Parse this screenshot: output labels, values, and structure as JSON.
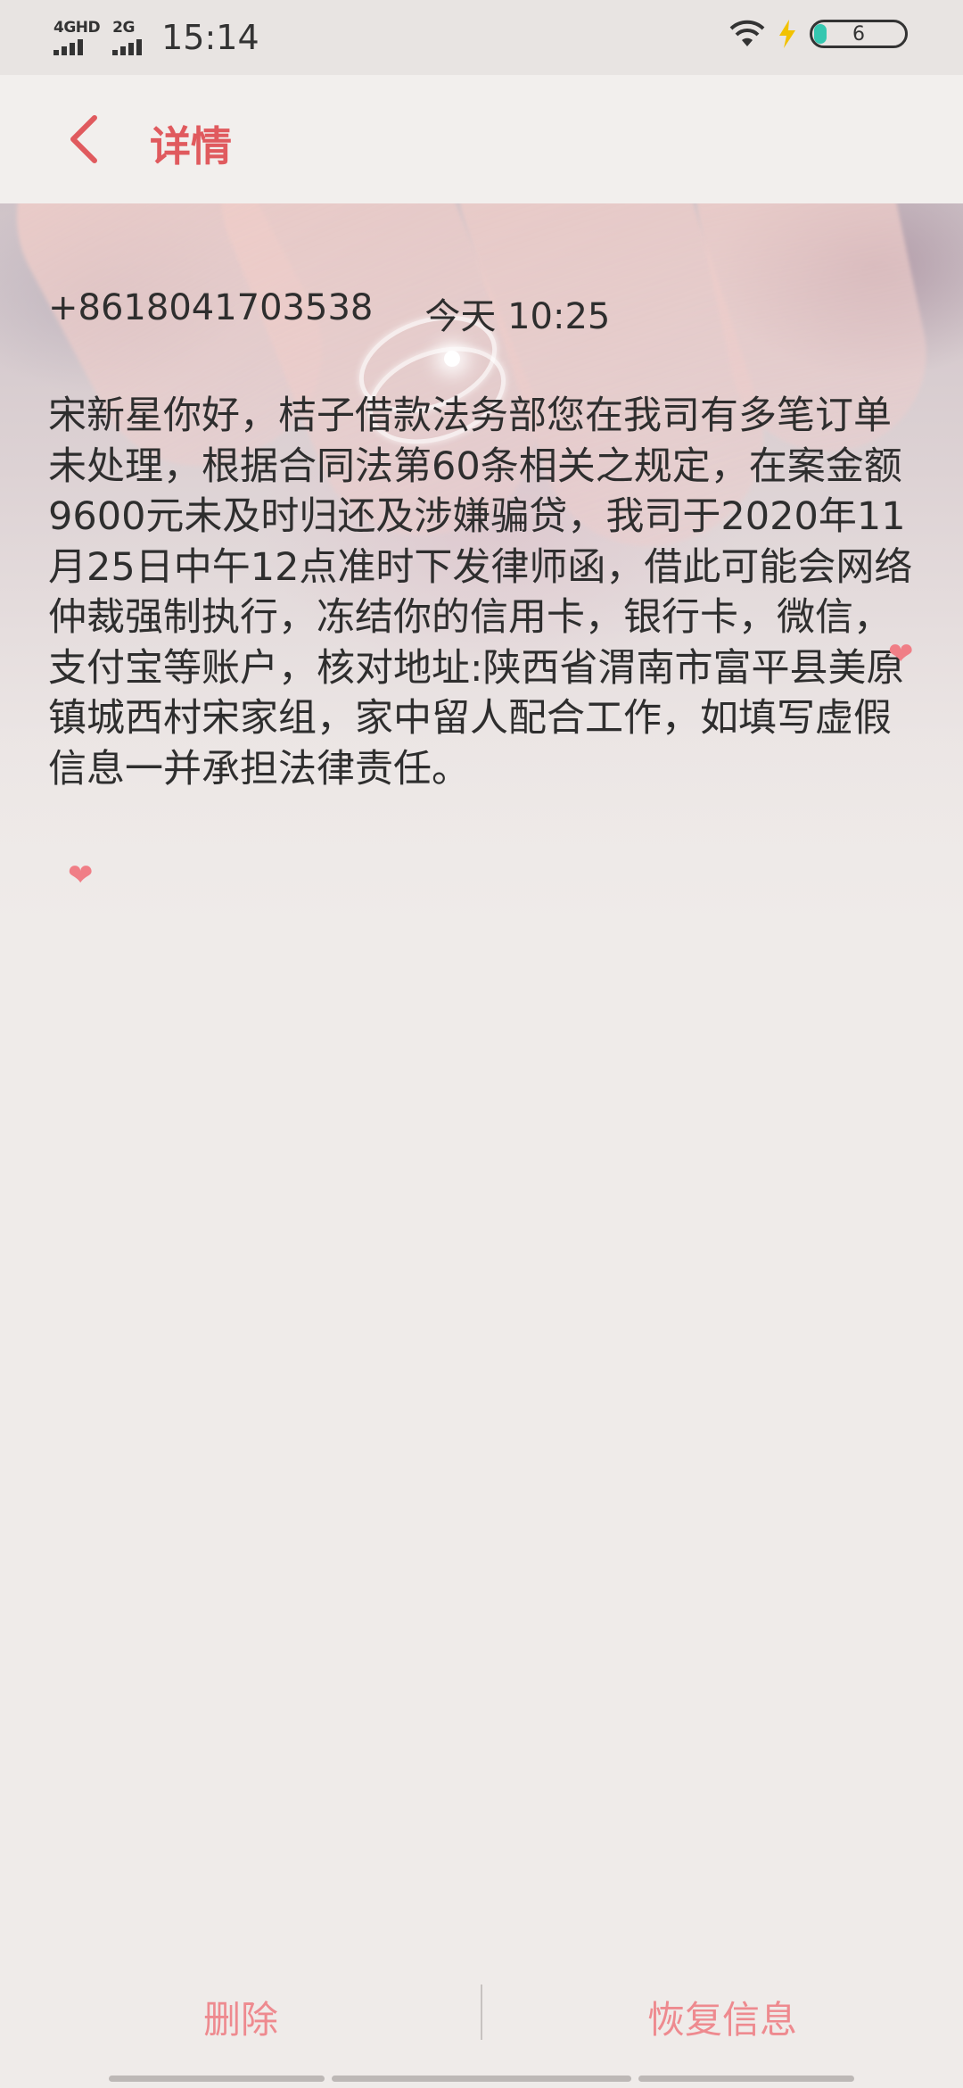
{
  "status_bar": {
    "network_1": "4GHD",
    "network_2": "2G",
    "time": "15:14",
    "battery_level": "6",
    "charging_color": "#f2c200",
    "battery_fill_color": "#35c7b0"
  },
  "header": {
    "title": "详情",
    "back_icon": "chevron-left-icon",
    "accent_color": "#e05a5e"
  },
  "message": {
    "sender": "+8618041703538",
    "timestamp": "今天 10:25",
    "body": "宋新星你好，桔子借款法务部您在我司有多笔订单未处理，根据合同法第60条相关之规定，在案金额9600元未及时归还及涉嫌骗贷，我司于2020年11月25日中午12点准时下发律师函，借此可能会网络仲裁强制执行，冻结你的信用卡，银行卡，微信，支付宝等账户，核对地址:陕西省渭南市富平县美原镇城西村宋家组，家中留人配合工作，如填写虚假信息一并承担法律责任。"
  },
  "actions": {
    "delete_label": "删除",
    "restore_label": "恢复信息",
    "action_color": "#ee8a8f"
  }
}
